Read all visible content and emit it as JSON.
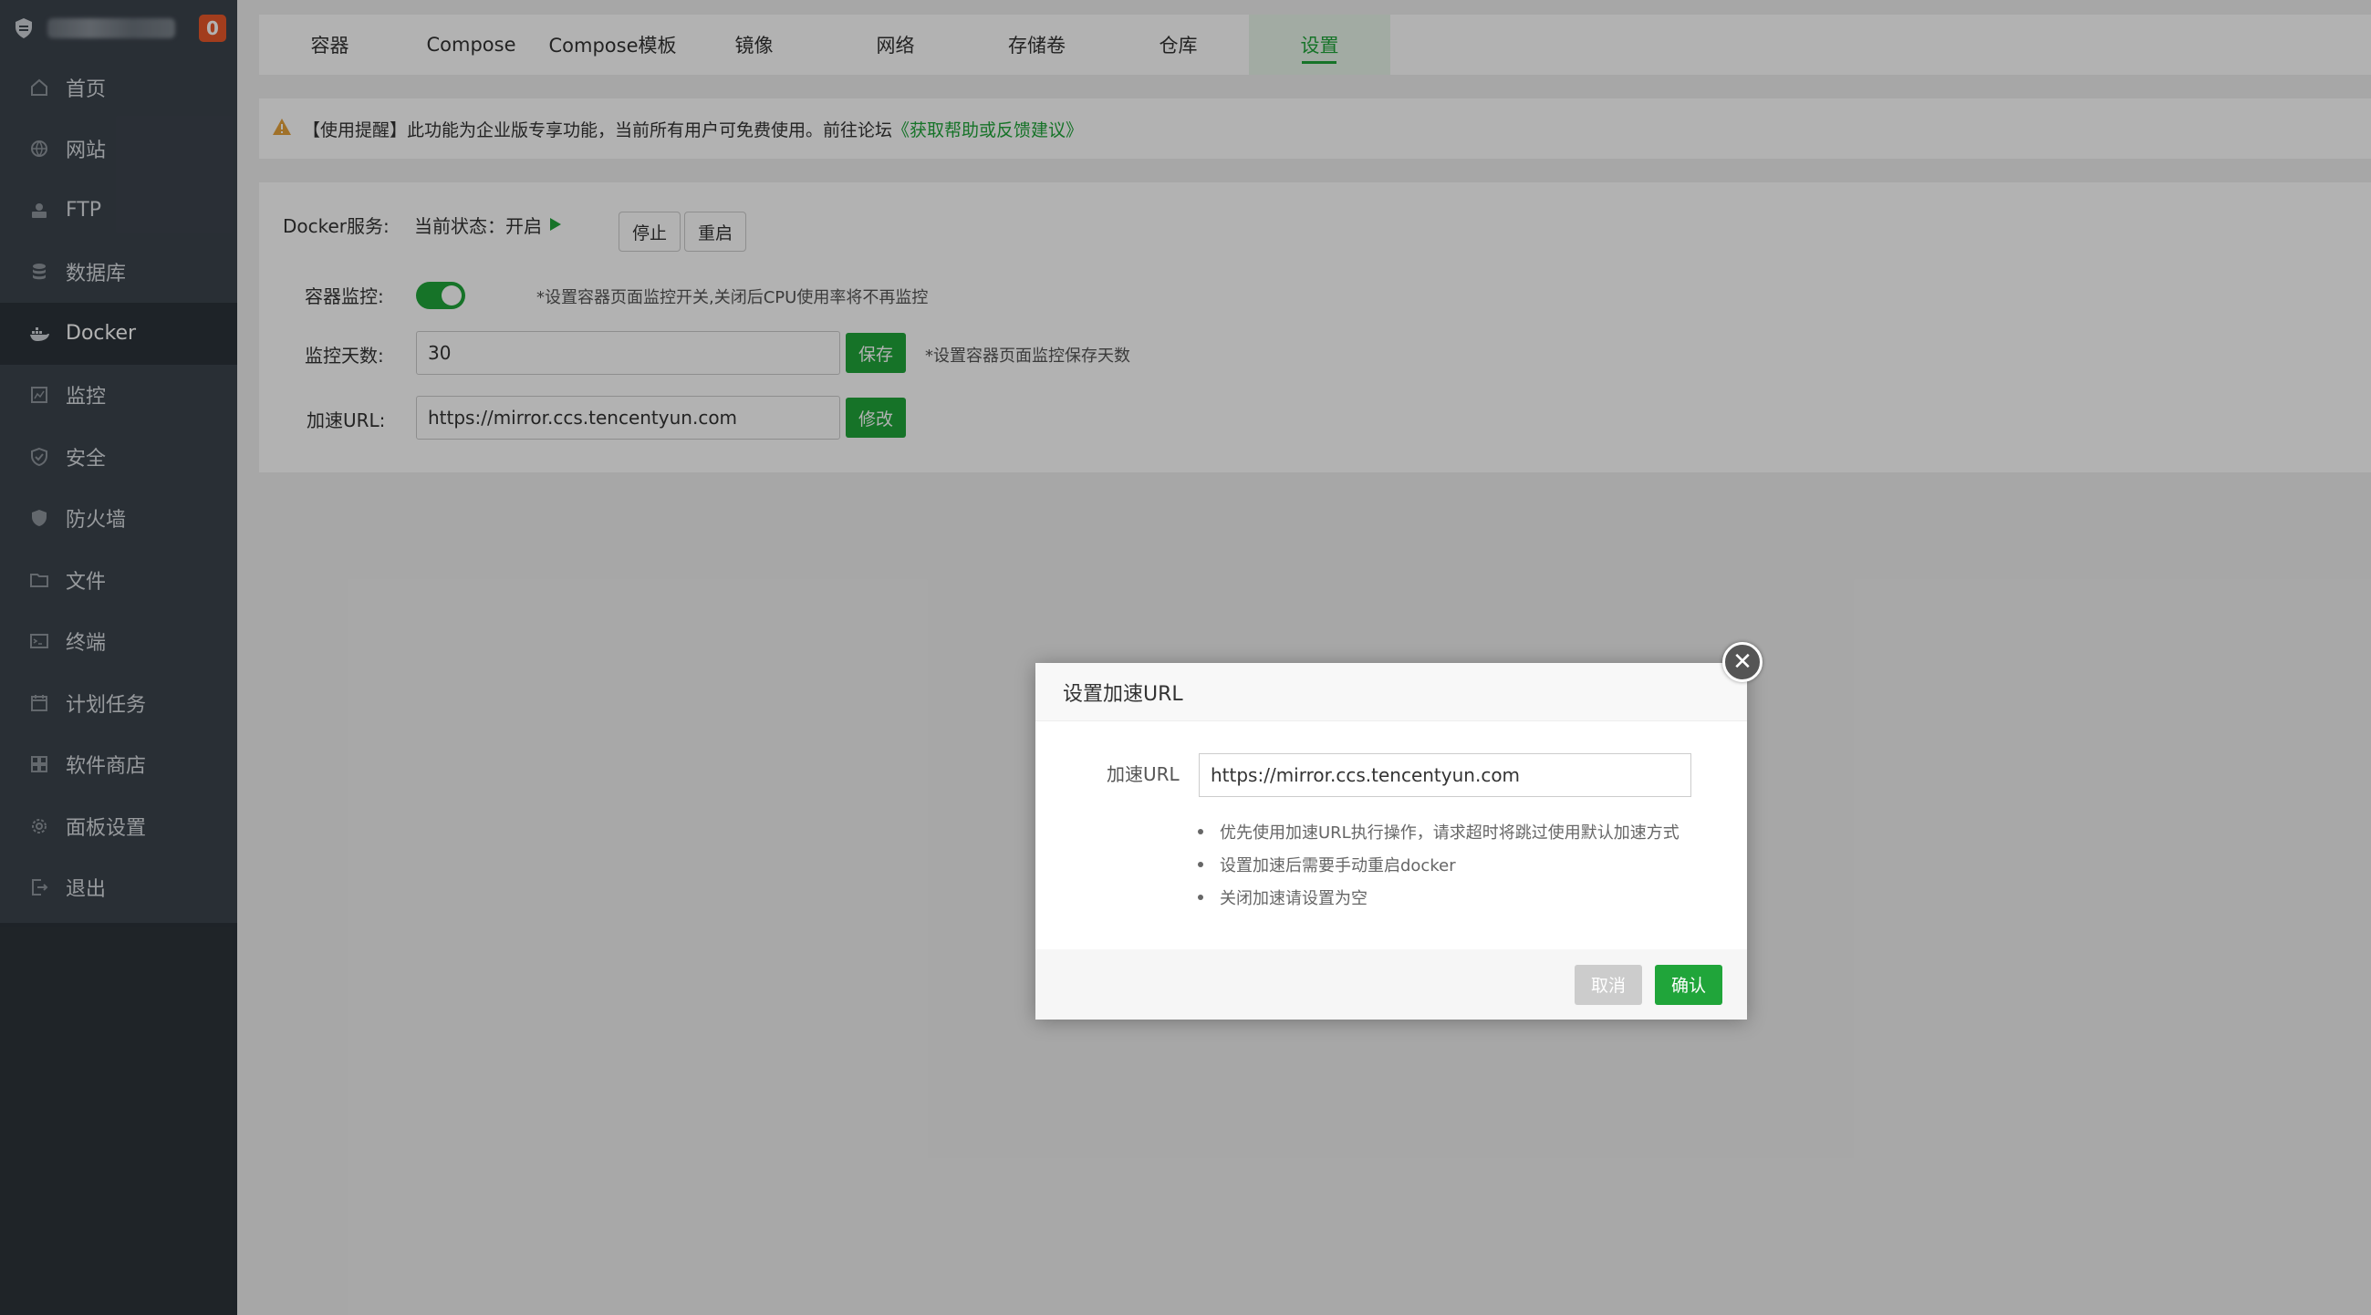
{
  "sidebar": {
    "badge": "0",
    "items": [
      {
        "label": "首页",
        "icon": "home-icon"
      },
      {
        "label": "网站",
        "icon": "globe-icon"
      },
      {
        "label": "FTP",
        "icon": "ftp-icon"
      },
      {
        "label": "数据库",
        "icon": "database-icon"
      },
      {
        "label": "Docker",
        "icon": "docker-icon"
      },
      {
        "label": "监控",
        "icon": "monitor-icon"
      },
      {
        "label": "安全",
        "icon": "shield-check-icon"
      },
      {
        "label": "防火墙",
        "icon": "firewall-icon"
      },
      {
        "label": "文件",
        "icon": "folder-icon"
      },
      {
        "label": "终端",
        "icon": "terminal-icon"
      },
      {
        "label": "计划任务",
        "icon": "calendar-icon"
      },
      {
        "label": "软件商店",
        "icon": "apps-grid-icon"
      },
      {
        "label": "面板设置",
        "icon": "gear-icon"
      },
      {
        "label": "退出",
        "icon": "logout-icon"
      }
    ]
  },
  "tabs": [
    "容器",
    "Compose",
    "Compose模板",
    "镜像",
    "网络",
    "存储卷",
    "仓库",
    "设置"
  ],
  "notice": {
    "text": "【使用提醒】此功能为企业版专享功能，当前所有用户可免费使用。前往论坛",
    "link": "《获取帮助或反馈建议》"
  },
  "settings": {
    "docker_service_label": "Docker服务:",
    "status_text": "当前状态：开启",
    "stop_label": "停止",
    "restart_label": "重启",
    "monitor_label": "容器监控:",
    "monitor_hint": "*设置容器页面监控开关,关闭后CPU使用率将不再监控",
    "days_label": "监控天数:",
    "days_value": "30",
    "save_label": "保存",
    "days_hint": "*设置容器页面监控保存天数",
    "url_label": "加速URL:",
    "url_value": "https://mirror.ccs.tencentyun.com",
    "modify_label": "修改"
  },
  "modal": {
    "title": "设置加速URL",
    "field_label": "加速URL",
    "field_value": "https://mirror.ccs.tencentyun.com",
    "tips": [
      "优先使用加速URL执行操作，请求超时将跳过使用默认加速方式",
      "设置加速后需要手动重启docker",
      "关闭加速请设置为空"
    ],
    "cancel_label": "取消",
    "confirm_label": "确认"
  },
  "colors": {
    "accent": "#20a53a",
    "sidebar": "#3c444d",
    "badge": "#e8582a",
    "warning": "#e6a23c"
  }
}
